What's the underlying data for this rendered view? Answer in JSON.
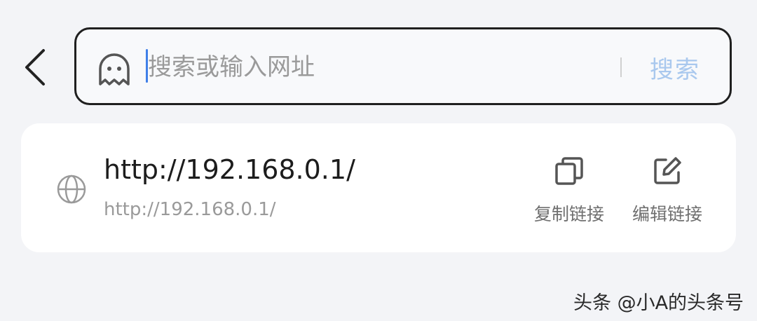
{
  "search": {
    "value": "",
    "placeholder": "搜索或输入网址",
    "submit_label": "搜索"
  },
  "result": {
    "title": "http://192.168.0.1/",
    "url": "http://192.168.0.1/",
    "actions": [
      {
        "label": "复制链接",
        "icon": "copy-icon"
      },
      {
        "label": "编辑链接",
        "icon": "edit-icon"
      }
    ]
  },
  "watermark": "头条 @小A的头条号",
  "colors": {
    "background": "#f3f4f7",
    "card": "#ffffff",
    "caret": "#3f7fe8",
    "submit_text": "#a9c8ee",
    "border": "#1f1f1f"
  }
}
